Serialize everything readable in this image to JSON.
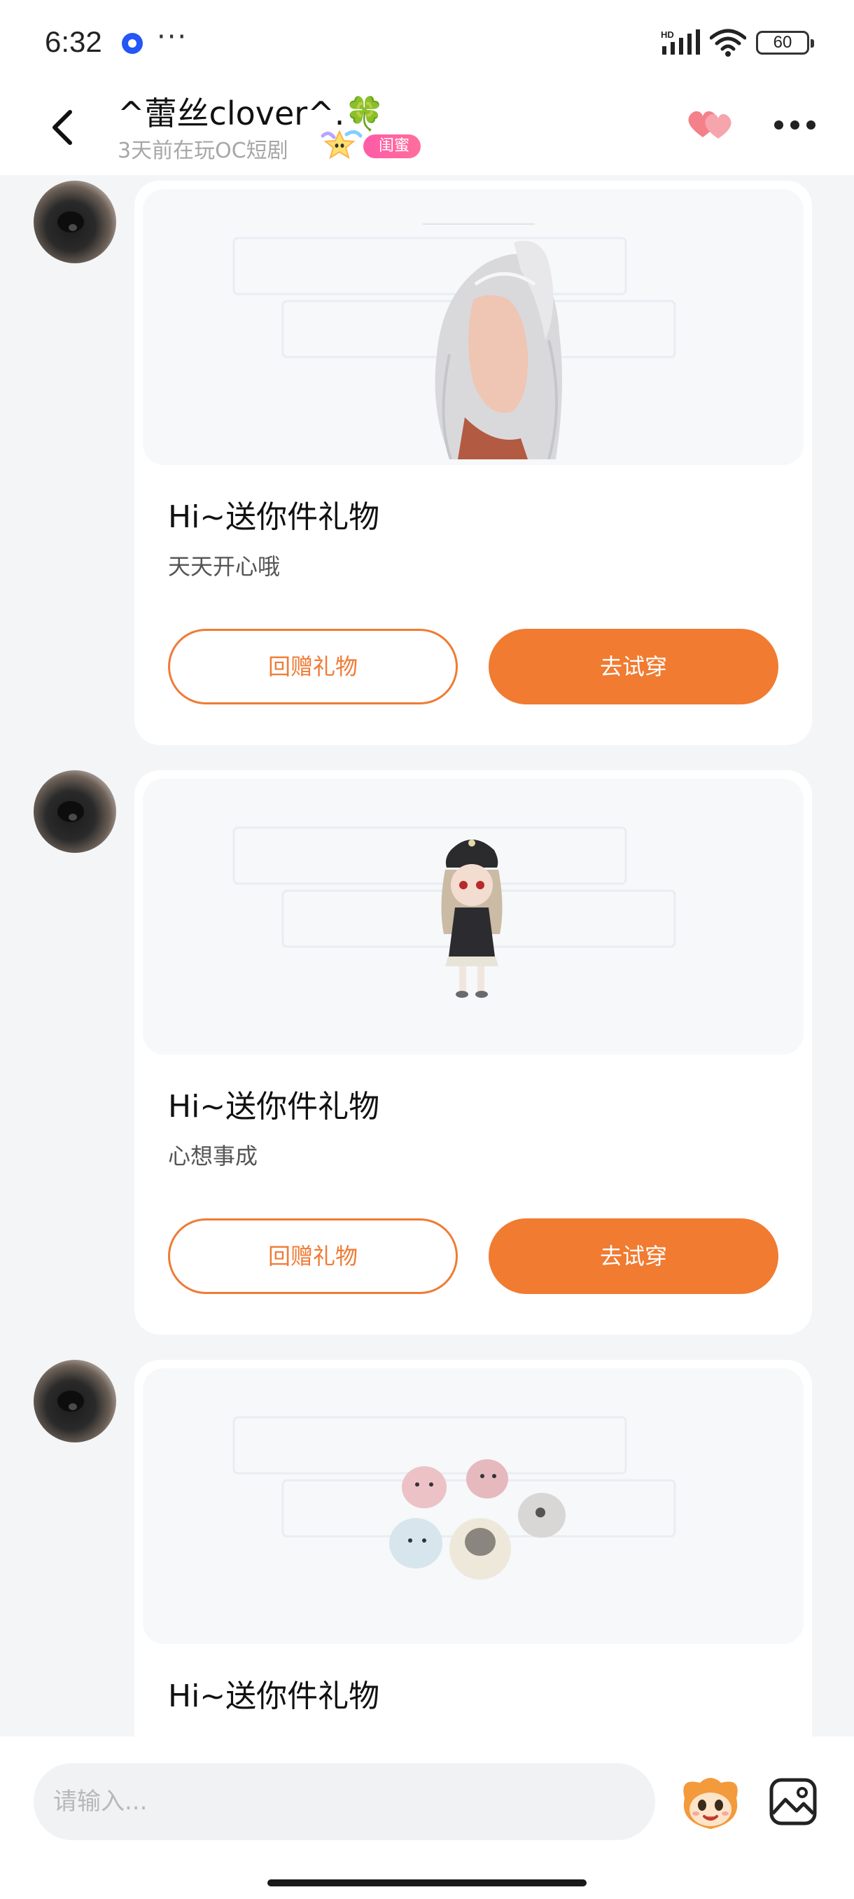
{
  "status_bar": {
    "time": "6:32",
    "notification_icon": "app-notification-icon",
    "more": "···",
    "network_label": "HD",
    "battery": "60"
  },
  "header": {
    "name": "^蕾丝clover^.🍀",
    "subtitle": "3天前在玩OC短剧",
    "badge": "闺蜜",
    "back_icon": "back-chevron-icon",
    "hearts_icon": "double-heart-icon",
    "more_icon": "more-dots-icon"
  },
  "colors": {
    "accent": "#f07b31",
    "badge_pink": "#ff5aa8",
    "background": "#f4f5f7"
  },
  "messages": [
    {
      "preview_icon": "gift-hair-ponytail-icon",
      "title": "Hi~送你件礼物",
      "text": "天天开心哦",
      "return_label": "回赠礼物",
      "try_label": "去试穿"
    },
    {
      "preview_icon": "gift-doll-outfit-icon",
      "title": "Hi~送你件礼物",
      "text": "心想事成",
      "return_label": "回赠礼物",
      "try_label": "去试穿"
    },
    {
      "preview_icon": "gift-chicks-pets-icon",
      "title": "Hi~送你件礼物"
    }
  ],
  "input": {
    "placeholder": "请输入...",
    "mascot_icon": "mascot-face-icon",
    "image_icon": "image-picker-icon"
  }
}
